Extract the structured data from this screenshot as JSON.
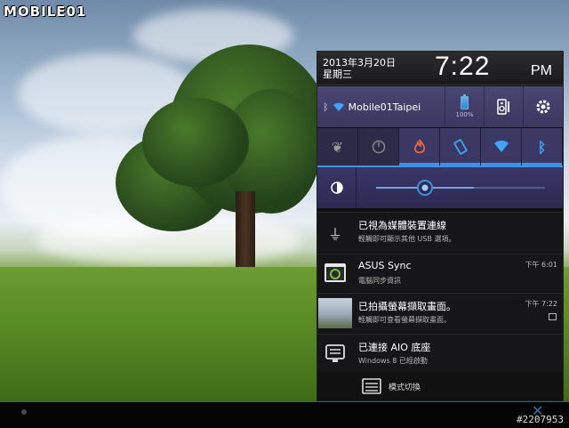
{
  "watermark": {
    "site_logo": "MOBILE01",
    "post_id": "#2207953"
  },
  "panel": {
    "date": "2013年3月20日",
    "weekday": "星期三",
    "time": "7:22",
    "ampm": "PM",
    "wifi_name": "Mobile01Taipei",
    "battery_pct": "100%",
    "brightness_level": 0.37
  },
  "toggles": [
    {
      "name": "power-saver-icon",
      "state": "off"
    },
    {
      "name": "performance-mode-icon",
      "state": "off"
    },
    {
      "name": "super-performance-icon",
      "state": "on-red"
    },
    {
      "name": "auto-rotate-icon",
      "state": "on-blue"
    },
    {
      "name": "wifi-toggle-icon",
      "state": "on-blue"
    },
    {
      "name": "bluetooth-toggle-icon",
      "state": "on-blue"
    }
  ],
  "notifications": [
    {
      "title": "已視為媒體裝置連線",
      "subtitle": "輕觸即可顯示其他 USB 選項。",
      "time": ""
    },
    {
      "title": "ASUS Sync",
      "subtitle": "電腦同步資訊",
      "time": "下午 6:01"
    },
    {
      "title": "已拍攝螢幕擷取畫面。",
      "subtitle": "輕觸即可查看螢幕擷取畫面。",
      "time": "下午 7:22"
    },
    {
      "title": "已連接 AIO 底座",
      "subtitle": "Windows 8 已經啟動",
      "time": ""
    }
  ],
  "action": {
    "label": "模式切換"
  },
  "colors": {
    "accent": "#3a95e0",
    "panel_bg": "#0f0f10",
    "status_bg": "#4a4672"
  }
}
